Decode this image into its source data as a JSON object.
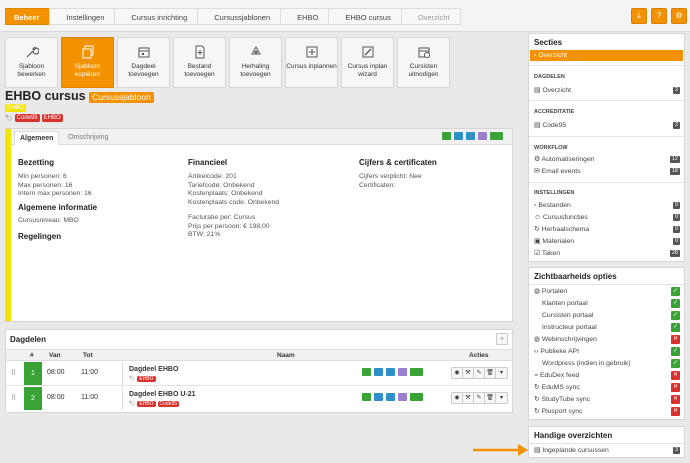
{
  "breadcrumbs": [
    "Beheer",
    "Instellingen",
    "Cursus inrichting",
    "Cursussjablonen",
    "EHBO",
    "EHBO cursus",
    "Overzicht"
  ],
  "toolbar": [
    {
      "label": "Sjabloon bewerken",
      "icon": "wrench-icon"
    },
    {
      "label": "Sjabloon kopiëren",
      "icon": "copy-icon"
    },
    {
      "label": "Dagdeel toevoegen",
      "icon": "calendar-icon"
    },
    {
      "label": "Bestand toevoegen",
      "icon": "file-add-icon"
    },
    {
      "label": "Herhaling toevoegen",
      "icon": "recycle-icon"
    },
    {
      "label": "Cursus inplannen",
      "icon": "plus-doc-icon"
    },
    {
      "label": "Cursus inplan wizard",
      "icon": "edit-icon"
    },
    {
      "label": "Cursisten uitnodigen",
      "icon": "calendar-invite-icon"
    }
  ],
  "title": "EHBO cursus",
  "title_badge": "Cursussjabloon",
  "tag_yellow": "EHBO",
  "tags": [
    "Code95",
    "EHBO"
  ],
  "tabs": [
    "Algemeen",
    "Omschrijving"
  ],
  "bezetting": {
    "heading": "Bezetting",
    "lines": [
      "Min personen: 6",
      "Max personen: 16",
      "Intern max personen: 16"
    ]
  },
  "algemene": {
    "heading": "Algemene informatie",
    "lines": [
      "Cursusniveau: MBO"
    ]
  },
  "regelingen": {
    "heading": "Regelingen"
  },
  "financieel": {
    "heading": "Financieel",
    "lines": [
      "Artikelcode: 201",
      "Tariefcode: Onbekend",
      "Kostenplaats: Onbekend",
      "Kostenplaats code: Onbekend"
    ],
    "lines2": [
      "Facturatie per: Cursus",
      "Prijs per persoon: € 198,00",
      "BTW: 21%"
    ]
  },
  "cijfers": {
    "heading": "Cijfers & certificaten",
    "lines": [
      "Cijfers verplicht: Nee",
      "Certificaten:"
    ]
  },
  "dagdelen": {
    "heading": "Dagdelen",
    "add": "+",
    "columns": [
      "#",
      "Van",
      "Tot",
      "Naam",
      "Acties"
    ],
    "rows": [
      {
        "num": "1",
        "van": "08:00",
        "tot": "11:00",
        "naam": "Dagdeel EHBO",
        "tags": [
          "EHBO"
        ]
      },
      {
        "num": "2",
        "van": "08:00",
        "tot": "11:00",
        "naam": "Dagdeel EHBO U-21",
        "tags": [
          "EHBO",
          "Code95"
        ]
      }
    ]
  },
  "secties": {
    "heading": "Secties",
    "active": "Overzicht",
    "groups": [
      {
        "title": "DAGDELEN",
        "items": [
          {
            "label": "Overzicht",
            "count": "2"
          }
        ]
      },
      {
        "title": "ACCREDITATIE",
        "items": [
          {
            "label": "Code95",
            "count": "2"
          }
        ]
      },
      {
        "title": "WORKFLOW",
        "items": [
          {
            "label": "Automatiseringen",
            "count": "12"
          },
          {
            "label": "Email events",
            "count": "18"
          }
        ]
      },
      {
        "title": "INSTELLINGEN",
        "items": [
          {
            "label": "Bestanden",
            "count": "0"
          },
          {
            "label": "Cursusfuncties",
            "count": "0"
          },
          {
            "label": "Herhaalschema",
            "count": "0"
          },
          {
            "label": "Materialen",
            "count": "0"
          },
          {
            "label": "Taken",
            "count": "28"
          }
        ]
      }
    ]
  },
  "zicht": {
    "heading": "Zichtbaarheids opties",
    "items": [
      {
        "label": "Portalen",
        "on": true,
        "indent": false
      },
      {
        "label": "Klanten portaal",
        "on": true,
        "indent": true
      },
      {
        "label": "Cursisten portaal",
        "on": true,
        "indent": true
      },
      {
        "label": "Instructeur portaal",
        "on": true,
        "indent": true
      },
      {
        "label": "Webinschrijvingen",
        "on": false,
        "indent": false
      },
      {
        "label": "Publieke API",
        "on": true,
        "indent": false
      },
      {
        "label": "Wordpress (indien in gebruik)",
        "on": true,
        "indent": true
      },
      {
        "label": "EduDex feed",
        "on": false,
        "indent": false
      },
      {
        "label": "EduMS sync",
        "on": false,
        "indent": false
      },
      {
        "label": "StudyTube sync",
        "on": false,
        "indent": false
      },
      {
        "label": "Plusport sync",
        "on": false,
        "indent": false
      }
    ]
  },
  "handige": {
    "heading": "Handige overzichten",
    "items": [
      {
        "label": "Ingeplande cursussen",
        "count": "3"
      }
    ]
  },
  "colors": {
    "accent": "#f39200",
    "green": "#3aa335",
    "red": "#d9312b",
    "yellow": "#f2e600"
  }
}
